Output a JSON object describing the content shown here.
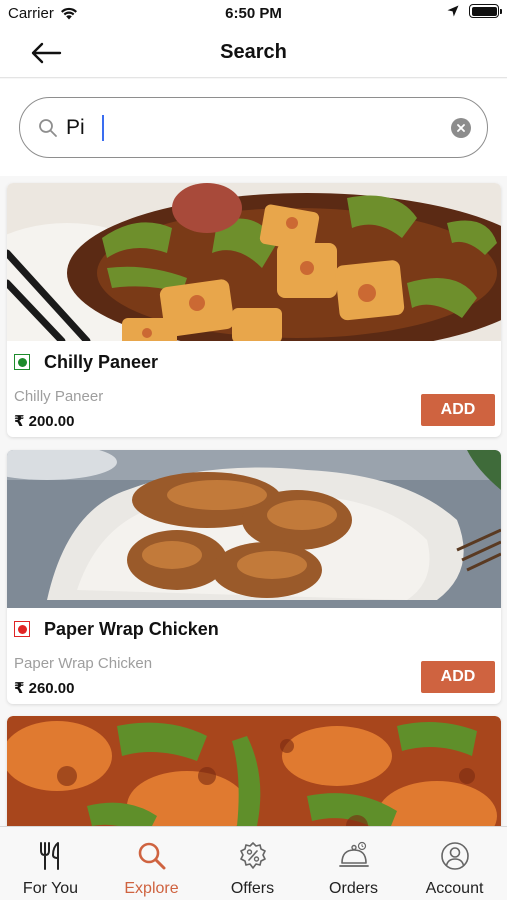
{
  "status_bar": {
    "carrier": "Carrier",
    "time": "6:50 PM"
  },
  "nav": {
    "title": "Search"
  },
  "search": {
    "value": "Pi"
  },
  "items": [
    {
      "name": "Chilly Paneer",
      "description": "Chilly Paneer",
      "price": "₹ 200.00",
      "add_label": "ADD",
      "type": "veg"
    },
    {
      "name": "Paper Wrap Chicken",
      "description": "Paper Wrap Chicken",
      "price": "₹ 260.00",
      "add_label": "ADD",
      "type": "non-veg"
    }
  ],
  "tabs": [
    {
      "label": "For You",
      "icon": "fork-knife-icon",
      "active": false
    },
    {
      "label": "Explore",
      "icon": "search-icon",
      "active": true
    },
    {
      "label": "Offers",
      "icon": "percent-badge-icon",
      "active": false
    },
    {
      "label": "Orders",
      "icon": "cloche-icon",
      "active": false
    },
    {
      "label": "Account",
      "icon": "user-circle-icon",
      "active": false
    }
  ],
  "colors": {
    "accent": "#cf6340",
    "veg": "#1d8b2b",
    "non_veg": "#e02424"
  }
}
